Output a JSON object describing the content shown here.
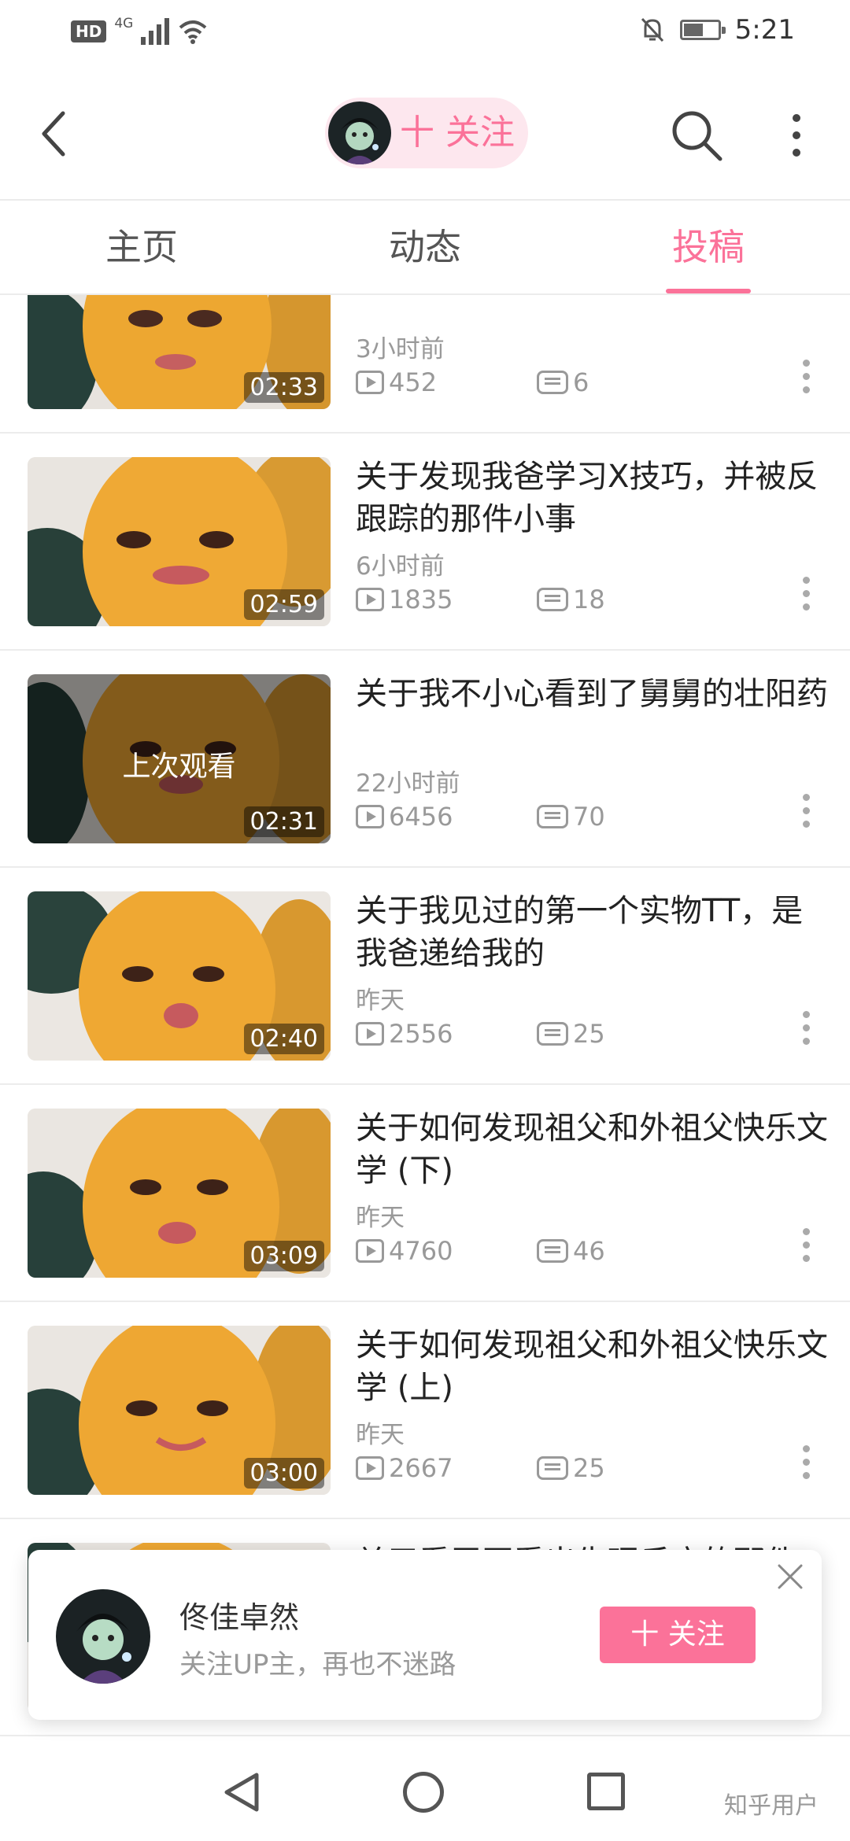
{
  "status_bar": {
    "network": "HD",
    "signal_label": "4G",
    "time": "5:21"
  },
  "header": {
    "follow_label": "十 关注",
    "icons": [
      "back-arrow-icon",
      "search-icon",
      "more-vert-icon"
    ]
  },
  "tabs": [
    {
      "label": "主页",
      "active": false
    },
    {
      "label": "动态",
      "active": false
    },
    {
      "label": "投稿",
      "active": true
    }
  ],
  "videos": [
    {
      "title": "",
      "time_ago": "3小时前",
      "views": "452",
      "comments": "6",
      "duration": "02:33",
      "watched_label": ""
    },
    {
      "title": "关于发现我爸学习X技巧，并被反跟踪的那件小事",
      "time_ago": "6小时前",
      "views": "1835",
      "comments": "18",
      "duration": "02:59",
      "watched_label": ""
    },
    {
      "title": "关于我不小心看到了舅舅的壮阳药",
      "time_ago": "22小时前",
      "views": "6456",
      "comments": "70",
      "duration": "02:31",
      "watched_label": "上次观看"
    },
    {
      "title": "关于我见过的第一个实物TT，是我爸递给我的",
      "time_ago": "昨天",
      "views": "2556",
      "comments": "25",
      "duration": "02:40",
      "watched_label": ""
    },
    {
      "title": "关于如何发现祖父和外祖父快乐文学 (下)",
      "time_ago": "昨天",
      "views": "4760",
      "comments": "46",
      "duration": "03:09",
      "watched_label": ""
    },
    {
      "title": "关于如何发现祖父和外祖父快乐文学 (上)",
      "time_ago": "昨天",
      "views": "2667",
      "comments": "25",
      "duration": "03:00",
      "watched_label": ""
    },
    {
      "title": "关于看牙医看出生理反应的那件",
      "time_ago": "",
      "views": "",
      "comments": "",
      "duration": "",
      "watched_label": ""
    }
  ],
  "follow_card": {
    "name": "佟佳卓然",
    "subtitle": "关注UP主，再也不迷路",
    "button_label": "十 关注"
  },
  "watermark": "知乎用户",
  "colors": {
    "accent": "#fb7299",
    "accent_light": "#fde7ee",
    "text_secondary": "#999999"
  }
}
